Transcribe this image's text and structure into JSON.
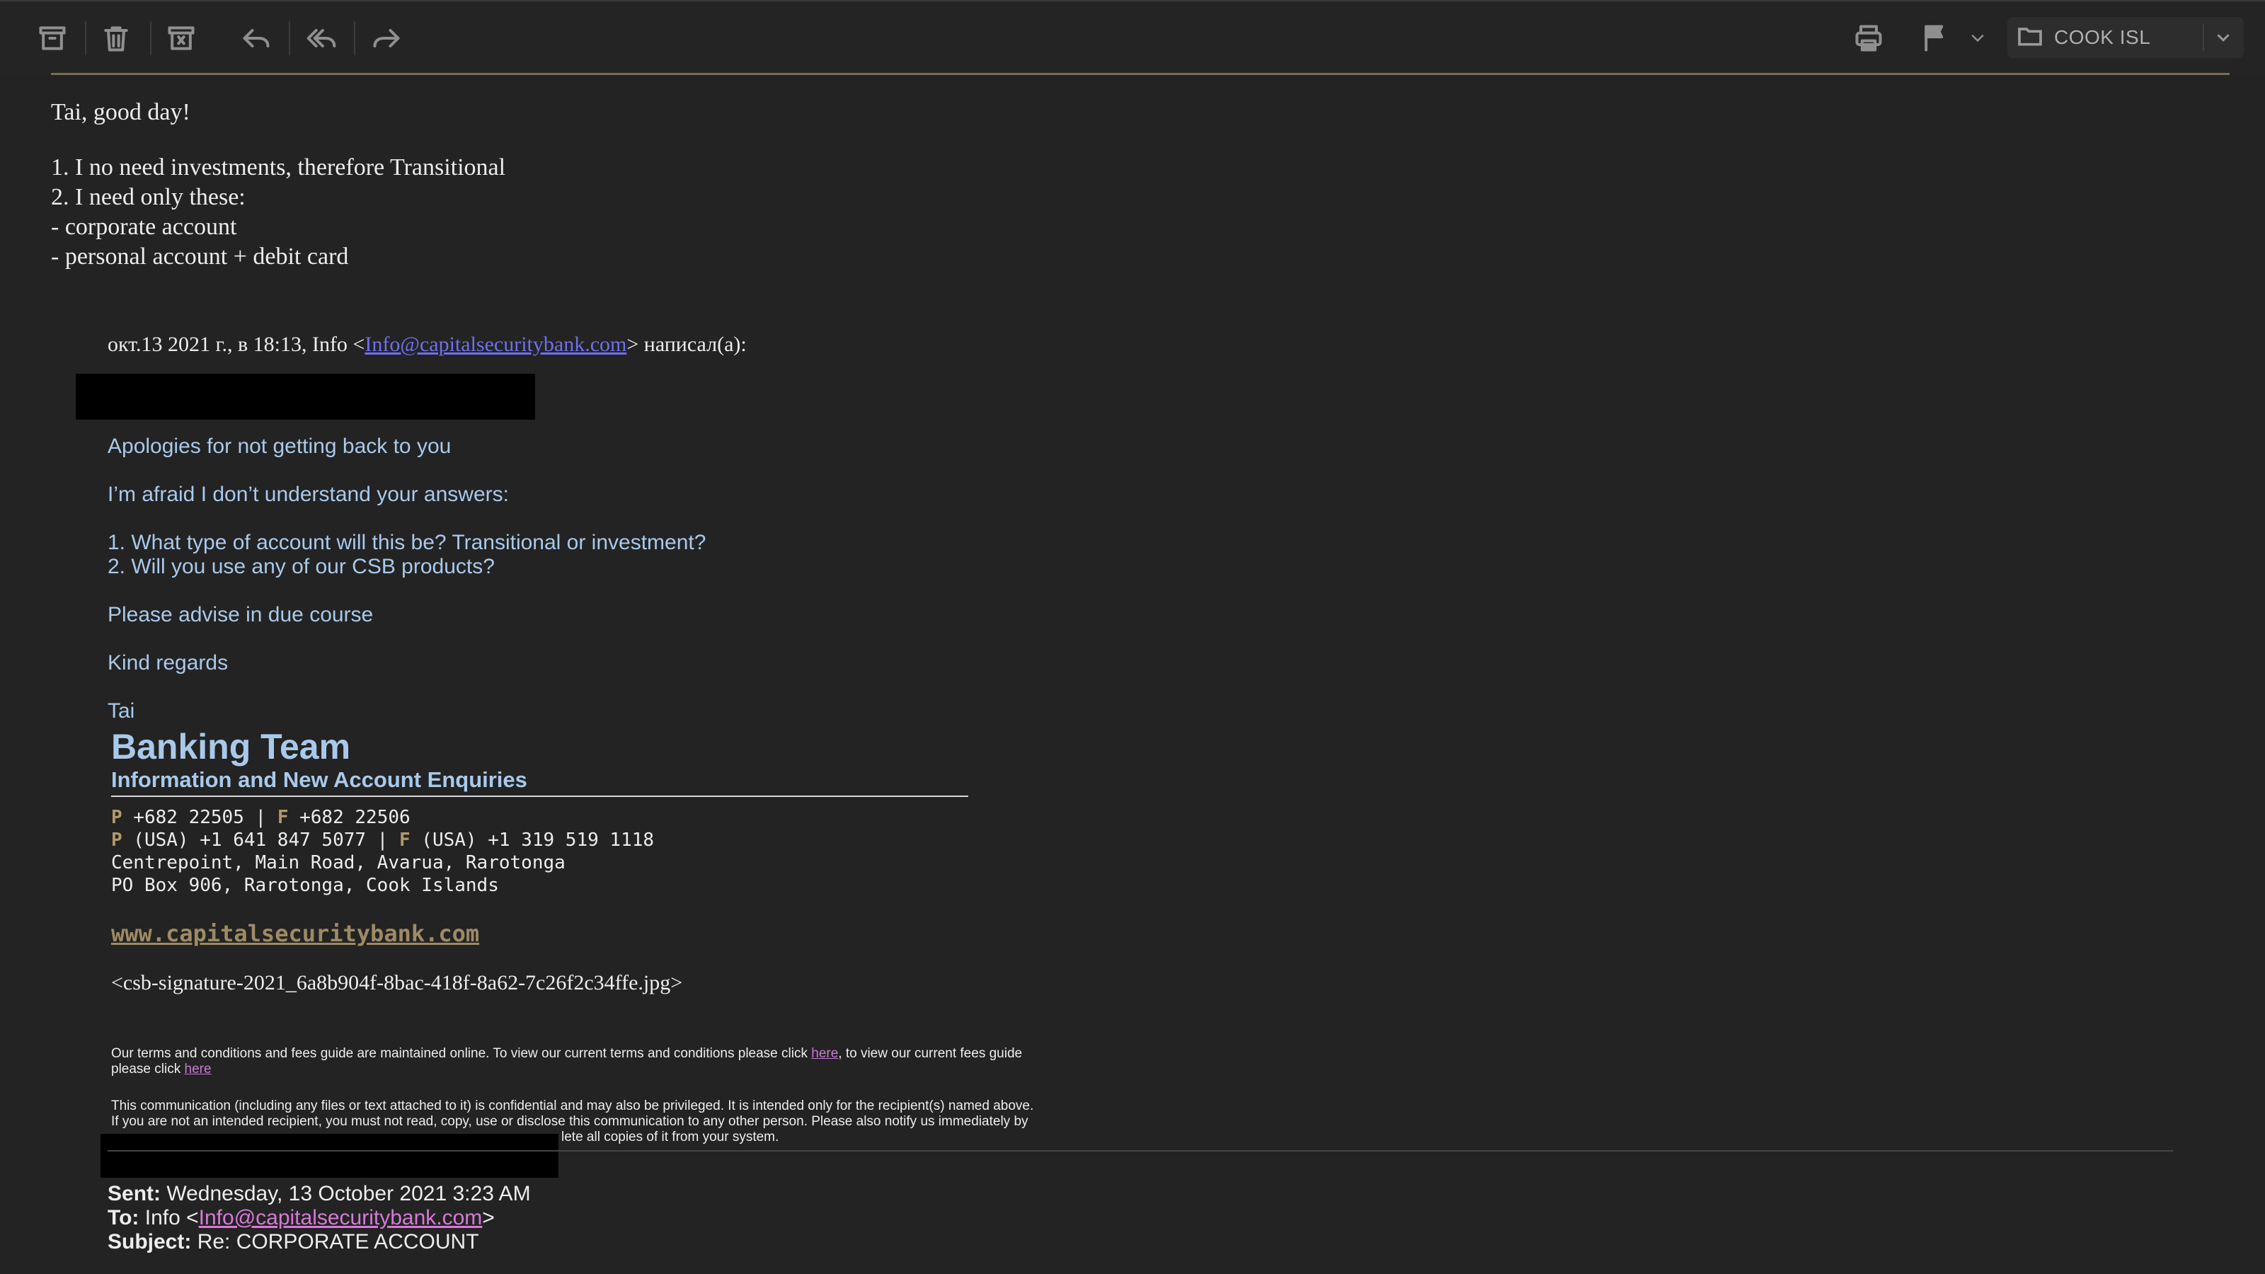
{
  "toolbar": {
    "icons": [
      "archive-icon",
      "trash-icon",
      "junk-icon",
      "reply-icon",
      "reply-all-icon",
      "forward-icon",
      "print-icon",
      "flag-icon",
      "chevron-down-icon"
    ],
    "folder": "COOK ISL"
  },
  "message": {
    "greeting": "Tai, good day!",
    "reply_lines": [
      "1. I no need investments, therefore Transitional",
      "2. I need only these:",
      "- corporate account",
      "- personal account + debit card"
    ],
    "quote_header": {
      "prefix": "окт.13 2021 г., в 18:13, Info <",
      "email": "Info@capitalsecuritybank.com",
      "suffix": "> написал(а):"
    },
    "quoted": {
      "lines": [
        "Apologies for not getting back to you",
        "I’m afraid I don’t understand your answers:",
        "1. What type of account will this be? Transitional or investment?",
        "2. Will you use any of our CSB products?",
        "Please advise in due course",
        "Kind regards",
        "Tai"
      ]
    },
    "signature": {
      "title": "Banking Team",
      "subtitle": "Information and New Account Enquiries",
      "p_label": "P",
      "f_label": "F",
      "phone1": " +682 22505 | ",
      "fax1": " +682 22506",
      "phone2": " (USA) +1 641 847 5077 | ",
      "fax2": " (USA) +1 319 519 1118",
      "address1": "Centrepoint, Main Road, Avarua, Rarotonga",
      "address2": "PO Box 906, Rarotonga, Cook Islands",
      "website": "www.capitalsecuritybank.com",
      "image": "<csb-signature-2021_6a8b904f-8bac-418f-8a62-7c26f2c34ffe.jpg>"
    },
    "terms": {
      "line1_a": "Our terms and conditions and fees guide are maintained online. To view our current terms and conditions please click ",
      "link1": "here",
      "line1_b": ", to view our current fees guide",
      "line2_a": "please click ",
      "link2": "here"
    },
    "disclaimer": {
      "line1": "This communication (including any files or text attached to it) is confidential and may also be privileged. It is intended only for the recipient(s) named above.",
      "line2": "If you are not an intended recipient, you must not read, copy, use or disclose this communication to any other person. Please also notify us immediately by",
      "line3": "lete all copies of it from your system."
    },
    "meta": {
      "sent_label": "Sent:",
      "sent": " Wednesday, 13 October 2021 3:23 AM",
      "to_label": "To:",
      "to_prefix": " Info <",
      "to_email": "Info@capitalsecuritybank.com",
      "to_suffix": ">",
      "subject_label": "Subject:",
      "subject": " Re: CORPORATE ACCOUNT"
    }
  }
}
